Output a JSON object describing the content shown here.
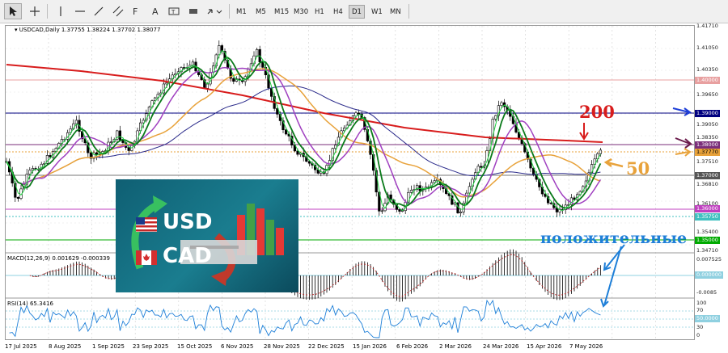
{
  "toolbar": {
    "tools": [
      "cursor-icon",
      "crosshair-icon",
      "vertical-line-icon",
      "horizontal-line-icon",
      "trendline-icon",
      "channel-icon",
      "fibonacci-icon",
      "text-icon",
      "text-label-icon",
      "shapes-icon",
      "arrows-icon"
    ],
    "timeframes": [
      "M1",
      "M5",
      "M15",
      "M30",
      "H1",
      "H4",
      "D1",
      "W1",
      "MN"
    ],
    "active_timeframe": "D1"
  },
  "chart": {
    "symbol_info": "USDCAD,Daily  1.37755 1.38224 1.37702 1.38077",
    "macd_label": "MACD(12,26,9) 0.001629 -0.000339",
    "rsi_label": "RSI(14) 65.3416",
    "price_scale": [
      "1.41710",
      "1.41050",
      "1.40350",
      "1.39650",
      "1.39050",
      "1.38350",
      "1.37510",
      "1.36810",
      "1.36100",
      "1.35400",
      "1.34710"
    ],
    "price_tags": {
      "p140000": {
        "text": "1.40000",
        "color": "#e8a0a0"
      },
      "p139000": {
        "text": "1.39000",
        "color": "#000080"
      },
      "p138000": {
        "text": "1.38000",
        "color": "#7a2e7a"
      },
      "p137770": {
        "text": "1.37770",
        "color": "#e8a23a"
      },
      "p137000": {
        "text": "1.37000",
        "color": "#555555"
      },
      "p136000": {
        "text": "1.36000",
        "color": "#c040c0"
      },
      "p135750": {
        "text": "1.35750",
        "color": "#40c0c0"
      },
      "p135000": {
        "text": "1.35000",
        "color": "#00aa00"
      }
    },
    "macd_scale": [
      "0.007525",
      "0.000000",
      "-0.0085"
    ],
    "rsi_scale": [
      "100",
      "70",
      "50.0000",
      "30",
      "0"
    ],
    "dates": [
      "17 Jul 2025",
      "8 Aug 2025",
      "1 Sep 2025",
      "23 Sep 2025",
      "15 Oct 2025",
      "6 Nov 2025",
      "28 Nov 2025",
      "22 Dec 2025",
      "15 Jan 2026",
      "6 Feb 2026",
      "2 Mar 2026",
      "24 Mar 2026",
      "15 Apr 2026",
      "7 May 2026"
    ],
    "annotations": {
      "ma200": "200",
      "ma50": "50",
      "positive": "положительные"
    },
    "logo": {
      "top": "USD",
      "bottom": "CAD",
      "top_flag": "us-flag-icon",
      "bottom_flag": "canada-flag-icon"
    }
  },
  "colors": {
    "ma200": "#d81c1c",
    "ma50": "#e8a23a",
    "annotation_arrow": "#1e7fd8",
    "bull_candle": "#000000",
    "bear_candle": "#000000"
  }
}
